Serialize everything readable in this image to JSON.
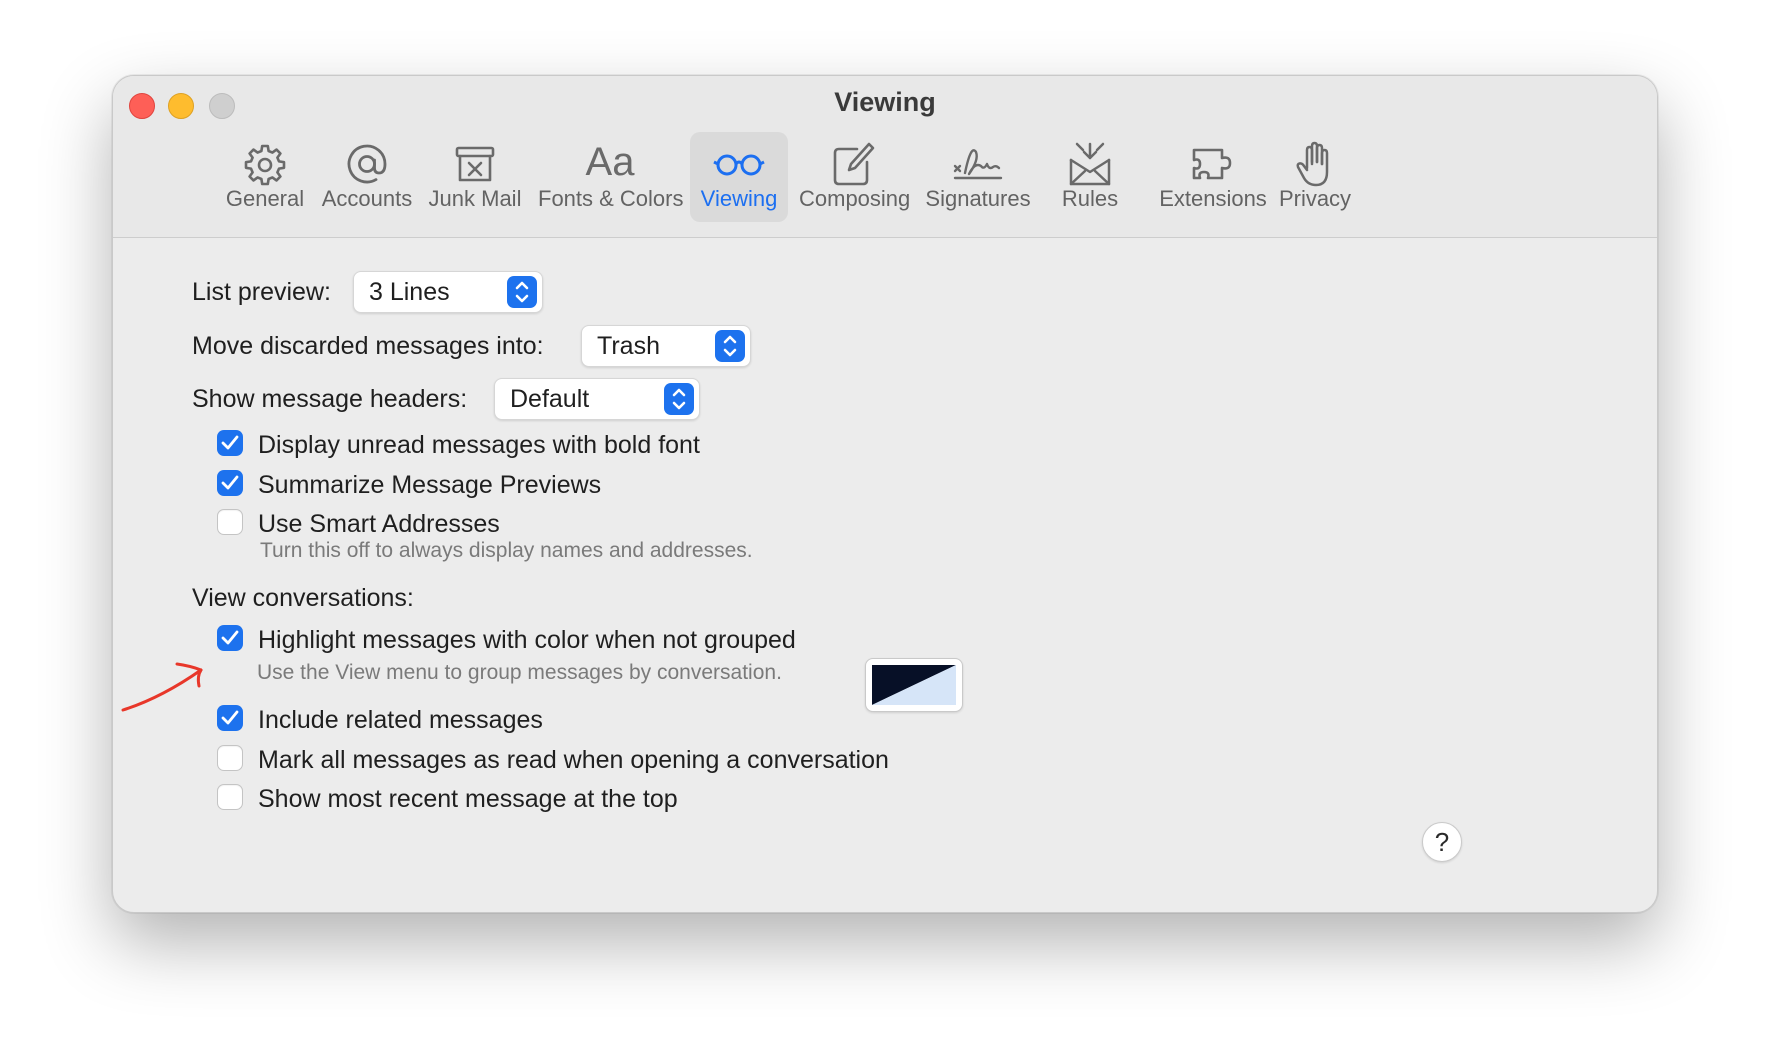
{
  "window": {
    "title": "Viewing"
  },
  "toolbar": {
    "items": [
      {
        "label": "General",
        "icon": "gear-icon"
      },
      {
        "label": "Accounts",
        "icon": "at-sign-icon"
      },
      {
        "label": "Junk Mail",
        "icon": "junk-mail-icon"
      },
      {
        "label": "Fonts & Colors",
        "icon": "fonts-icon",
        "glyph": "Aa"
      },
      {
        "label": "Viewing",
        "icon": "glasses-icon",
        "active": true
      },
      {
        "label": "Composing",
        "icon": "compose-icon"
      },
      {
        "label": "Signatures",
        "icon": "signature-icon"
      },
      {
        "label": "Rules",
        "icon": "rules-icon"
      },
      {
        "label": "Extensions",
        "icon": "puzzle-icon"
      },
      {
        "label": "Privacy",
        "icon": "hand-icon"
      }
    ]
  },
  "settings": {
    "list_preview": {
      "label": "List preview:",
      "value": "3 Lines"
    },
    "move_discarded": {
      "label": "Move discarded messages into:",
      "value": "Trash"
    },
    "show_headers": {
      "label": "Show message headers:",
      "value": "Default"
    },
    "checkboxes": [
      {
        "label": "Display unread messages with bold font",
        "checked": true
      },
      {
        "label": "Summarize Message Previews",
        "checked": true
      },
      {
        "label": "Use Smart Addresses",
        "checked": false,
        "hint": "Turn this off to always display names and addresses."
      }
    ],
    "view_conversations": {
      "heading": "View conversations:",
      "options": [
        {
          "label": "Highlight messages with color when not grouped",
          "checked": true,
          "hint": "Use the View menu to group messages by conversation."
        },
        {
          "label": "Include related messages",
          "checked": true
        },
        {
          "label": "Mark all messages as read when opening a conversation",
          "checked": false
        },
        {
          "label": "Show most recent message at the top",
          "checked": false
        }
      ],
      "highlight_colors": {
        "dark": "#071027",
        "light": "#d6e5f8"
      }
    },
    "help_label": "?"
  },
  "colors": {
    "accent": "#1d72ee",
    "annotation_arrow": "#e8372a"
  }
}
